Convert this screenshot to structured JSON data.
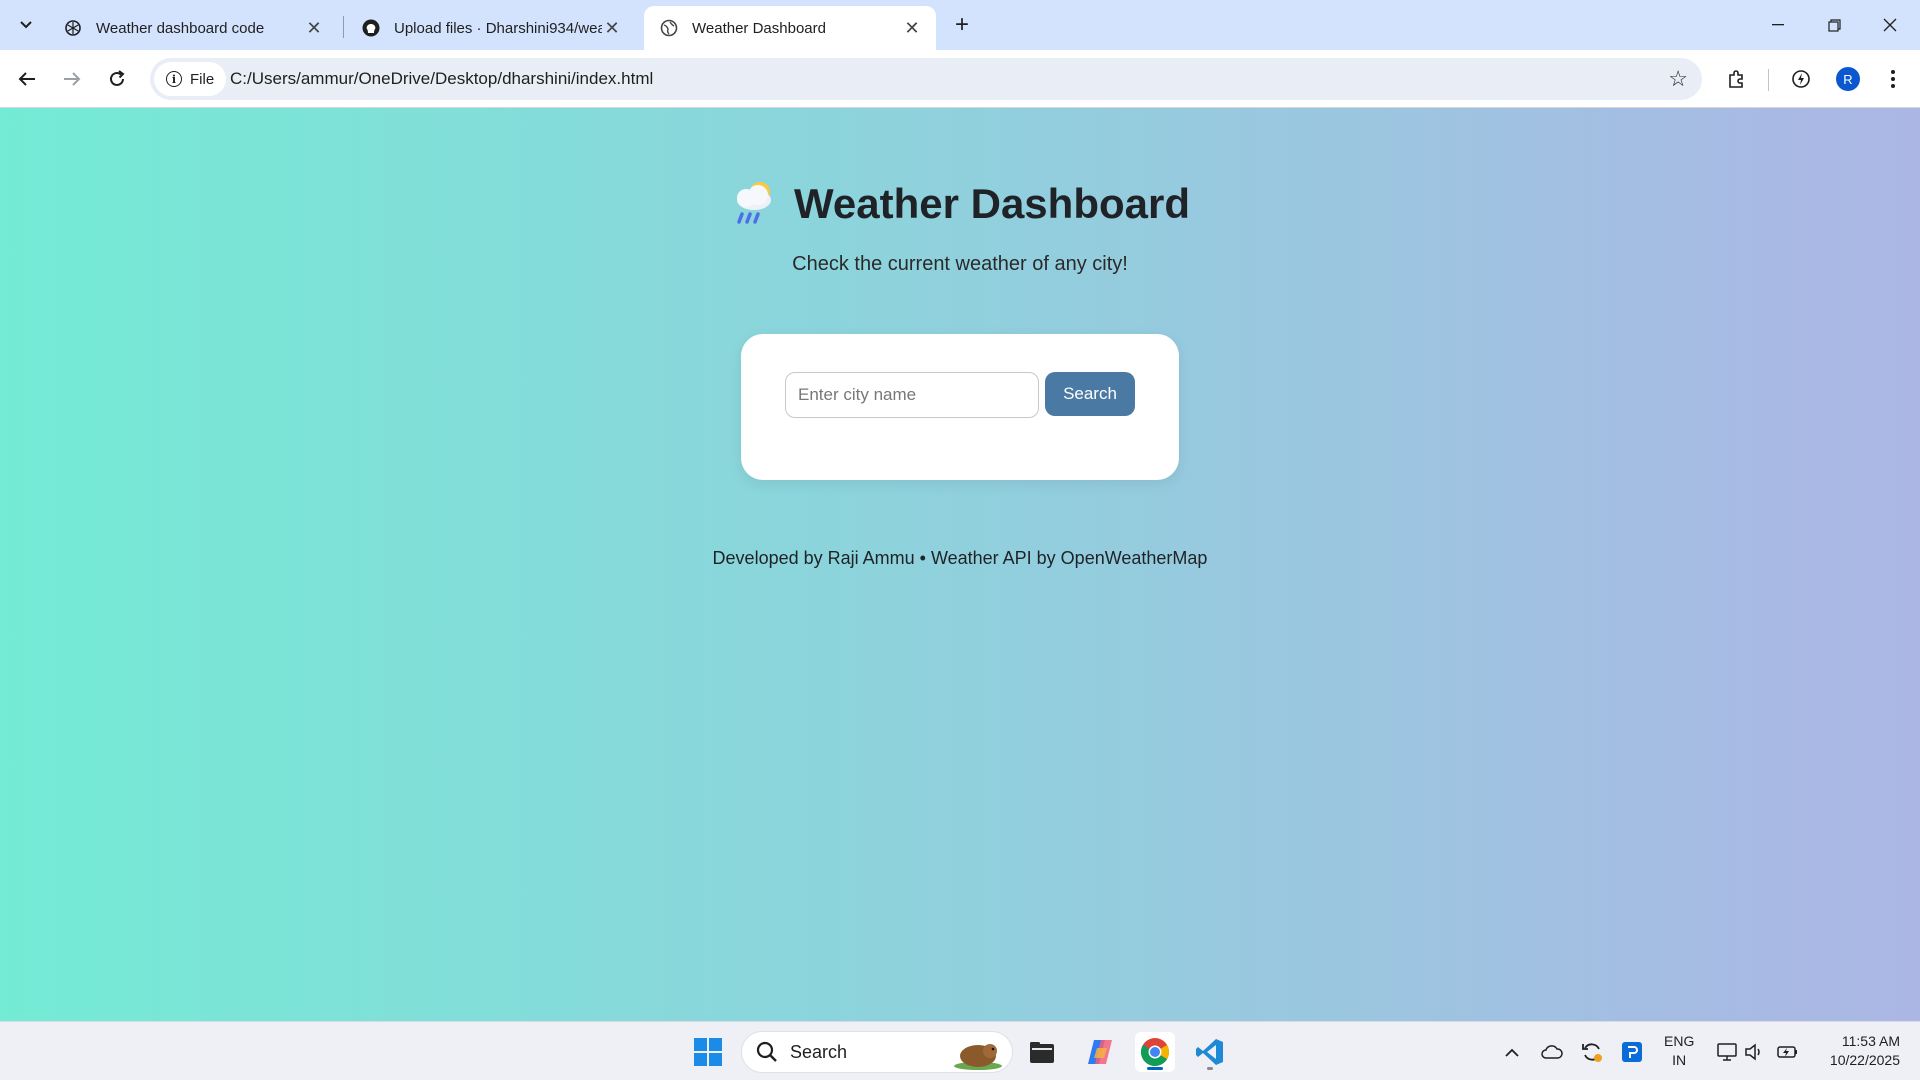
{
  "browser": {
    "tabs": [
      {
        "title": "Weather dashboard code",
        "icon": "chatgpt-icon",
        "active": false
      },
      {
        "title": "Upload files · Dharshini934/wea",
        "icon": "github-icon",
        "active": false
      },
      {
        "title": "Weather Dashboard",
        "icon": "globe-icon",
        "active": true
      }
    ],
    "omnibox": {
      "chip_label": "File",
      "url": "C:/Users/ammur/OneDrive/Desktop/dharshini/index.html"
    },
    "profile_initial": "R"
  },
  "page": {
    "title": "Weather Dashboard",
    "title_emoji": "cloud-rain-sun-icon",
    "subtitle": "Check the current weather of any city!",
    "search": {
      "placeholder": "Enter city name",
      "value": "",
      "button_label": "Search"
    },
    "footer": "Developed by Raji Ammu • Weather API by OpenWeatherMap",
    "colors": {
      "gradient_start": "#74ebd5",
      "gradient_end": "#acb6e5",
      "button": "#4a7aa3"
    }
  },
  "taskbar": {
    "search_label": "Search",
    "apps": [
      "windows-start-icon",
      "search-box",
      "file-explorer-icon",
      "copilot-icon",
      "chrome-icon",
      "vscode-icon"
    ],
    "tray": {
      "lang_line1": "ENG",
      "lang_line2": "IN",
      "time": "11:53 AM",
      "date": "10/22/2025"
    }
  }
}
